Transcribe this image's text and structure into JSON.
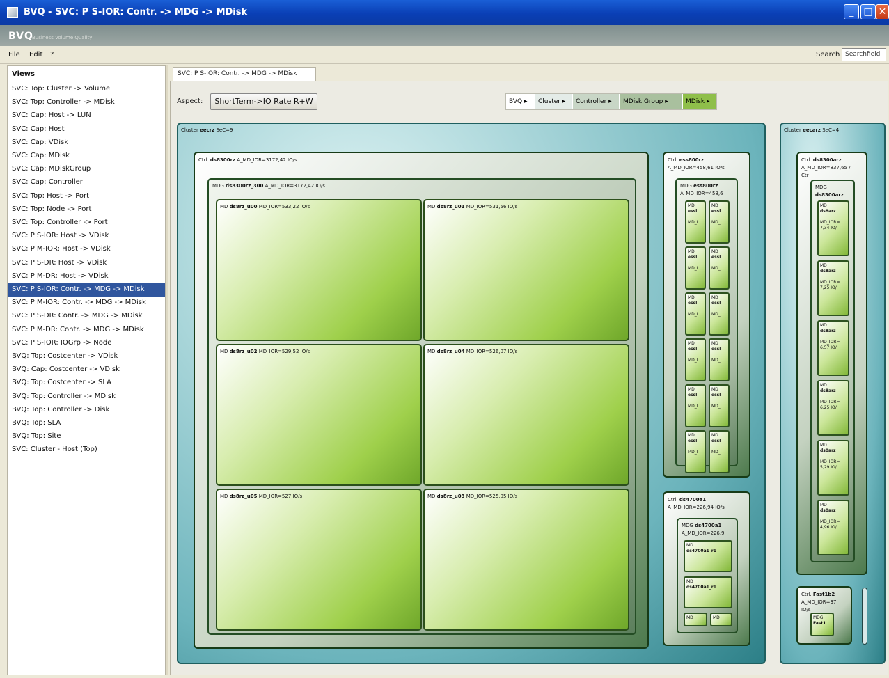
{
  "window": {
    "title": "BVQ - SVC: P S-IOR: Contr. -> MDG -> MDisk"
  },
  "brand": {
    "logo": "BVQ",
    "subtitle": "Business Volume Quality"
  },
  "menu": {
    "file": "File",
    "edit": "Edit",
    "help": "?",
    "search_label": "Search",
    "search_value": "Searchfield"
  },
  "sidebar": {
    "header": "Views",
    "items": [
      "SVC: Top: Cluster -> Volume",
      "SVC: Top: Controller -> MDisk",
      "SVC: Cap: Host -> LUN",
      "SVC: Cap: Host",
      "SVC: Cap: VDisk",
      "SVC: Cap: MDisk",
      "SVC: Cap: MDiskGroup",
      "SVC: Cap: Controller",
      "SVC: Top: Host -> Port",
      "SVC: Top: Node -> Port",
      "SVC: Top: Controller -> Port",
      "SVC: P S-IOR: Host -> VDisk",
      "SVC: P M-IOR: Host -> VDisk",
      "SVC: P S-DR: Host -> VDisk",
      "SVC: P M-DR: Host -> VDisk",
      "SVC: P S-IOR: Contr. -> MDG -> MDisk",
      "SVC: P M-IOR: Contr. -> MDG -> MDisk",
      "SVC: P S-DR: Contr. -> MDG -> MDisk",
      "SVC: P M-DR: Contr. -> MDG -> MDisk",
      "SVC: P S-IOR: IOGrp -> Node",
      "BVQ: Top: Costcenter -> VDisk",
      "BVQ: Cap: Costcenter -> VDisk",
      "BVQ: Top: Costcenter -> SLA",
      "BVQ: Top: Controller -> MDisk",
      "BVQ: Top: Controller -> Disk",
      "BVQ: Top: SLA",
      "BVQ: Top: Site",
      "SVC: Cluster - Host (Top)"
    ],
    "selected_index": 15
  },
  "tab": {
    "label": "SVC: P S-IOR: Contr. -> MDG -> MDisk"
  },
  "aspect": {
    "label": "Aspect:",
    "value": "ShortTerm->IO Rate R+W"
  },
  "breadcrumb": [
    "BVQ ▸",
    "Cluster ▸",
    "Controller ▸",
    "MDisk Group ▸",
    "MDisk ▸"
  ],
  "colors": {
    "cluster": "#2c7f87",
    "controller": "#4d7a4d",
    "mdisk": "#9fd04b",
    "selection": "#30569e",
    "titlebar": "#0a3fb5"
  },
  "treemap": {
    "cluster_a": {
      "label": "Cluster ",
      "name": "eecrz",
      "suffix": " SeC=9"
    },
    "ctrl_a": {
      "label": "Ctrl. ",
      "name": "ds8300rz",
      "suffix": " A_MD_IOR=3172,42 IO/s"
    },
    "mdg_a": {
      "label": "MDG ",
      "name": "ds8300rz_300",
      "suffix": " A_MD_IOR=3172,42 IO/s"
    },
    "mdisks": [
      {
        "label": "MD ",
        "name": "ds8rz_u00",
        "suffix": " MD_IOR=533,22 IO/s"
      },
      {
        "label": "MD ",
        "name": "ds8rz_u01",
        "suffix": " MD_IOR=531,56 IO/s"
      },
      {
        "label": "MD ",
        "name": "ds8rz_u02",
        "suffix": " MD_IOR=529,52 IO/s"
      },
      {
        "label": "MD ",
        "name": "ds8rz_u04",
        "suffix": " MD_IOR=526,07 IO/s"
      },
      {
        "label": "MD ",
        "name": "ds8rz_u05",
        "suffix": " MD_IOR=527 IO/s"
      },
      {
        "label": "MD ",
        "name": "ds8rz_u03",
        "suffix": " MD_IOR=525,05 IO/s"
      }
    ],
    "ctrl_b": {
      "label": "Ctrl. ",
      "name": "ess800rz",
      "line2": "A_MD_IOR=458,61 IO/s"
    },
    "mdg_b": {
      "label": "MDG ",
      "name": "ess800rz",
      "line2": "A_MD_IOR=458,6"
    },
    "small_md": {
      "line1": "MD",
      "line2": "essl",
      "line3": "MD_I"
    },
    "ctrl_c": {
      "label": "Ctrl. ",
      "name": "ds4700a1",
      "line2": "A_MD_IOR=226,94 IO/s"
    },
    "mdg_c": {
      "label": "MDG ",
      "name": "ds4700a1",
      "line2": "A_MD_IOR=226,9"
    },
    "md_c": {
      "line1": "MD",
      "line2": "ds4700a1_r1"
    },
    "md_c_small": "MD",
    "cluster_b": {
      "label": "Cluster ",
      "name": "eecarz",
      "suffix": " SeC=4"
    },
    "ctrl_d": {
      "label": "Ctrl. ",
      "name": "ds8300arz",
      "line2": "A_MD_IOR=837,65 /",
      "line3": "Ctr"
    },
    "mdg_d": {
      "line1": "MDG",
      "line2": "ds8300arz"
    },
    "md_d_first": {
      "line1": "MD",
      "line2": "ds8arz",
      "line3": "MD_IOR=",
      "line4": "7,34 IO/"
    },
    "md_d": [
      {
        "line1": "MD",
        "line2": "ds8arz",
        "line3": "MD_IOR=",
        "line4": "7,25 IO/"
      },
      {
        "line1": "MD",
        "line2": "ds8arz",
        "line3": "MD_IOR=",
        "line4": "6,57 IO/"
      },
      {
        "line1": "MD",
        "line2": "ds8arz",
        "line3": "MD_IOR=",
        "line4": "6,25 IO/"
      },
      {
        "line1": "MD",
        "line2": "ds8arz",
        "line3": "MD_IOR=",
        "line4": "5,29 IO/"
      },
      {
        "line1": "MD",
        "line2": "ds8arz",
        "line3": "MD_IOR=",
        "line4": "4,96 IO/"
      }
    ],
    "ctrl_e": {
      "label": "Ctrl. ",
      "name": "Fast1b2",
      "line2": "A_MD_IOR=37",
      "line3": "IO/s"
    },
    "mdg_e": {
      "line1": "MDG",
      "line2": "Fast1"
    }
  }
}
